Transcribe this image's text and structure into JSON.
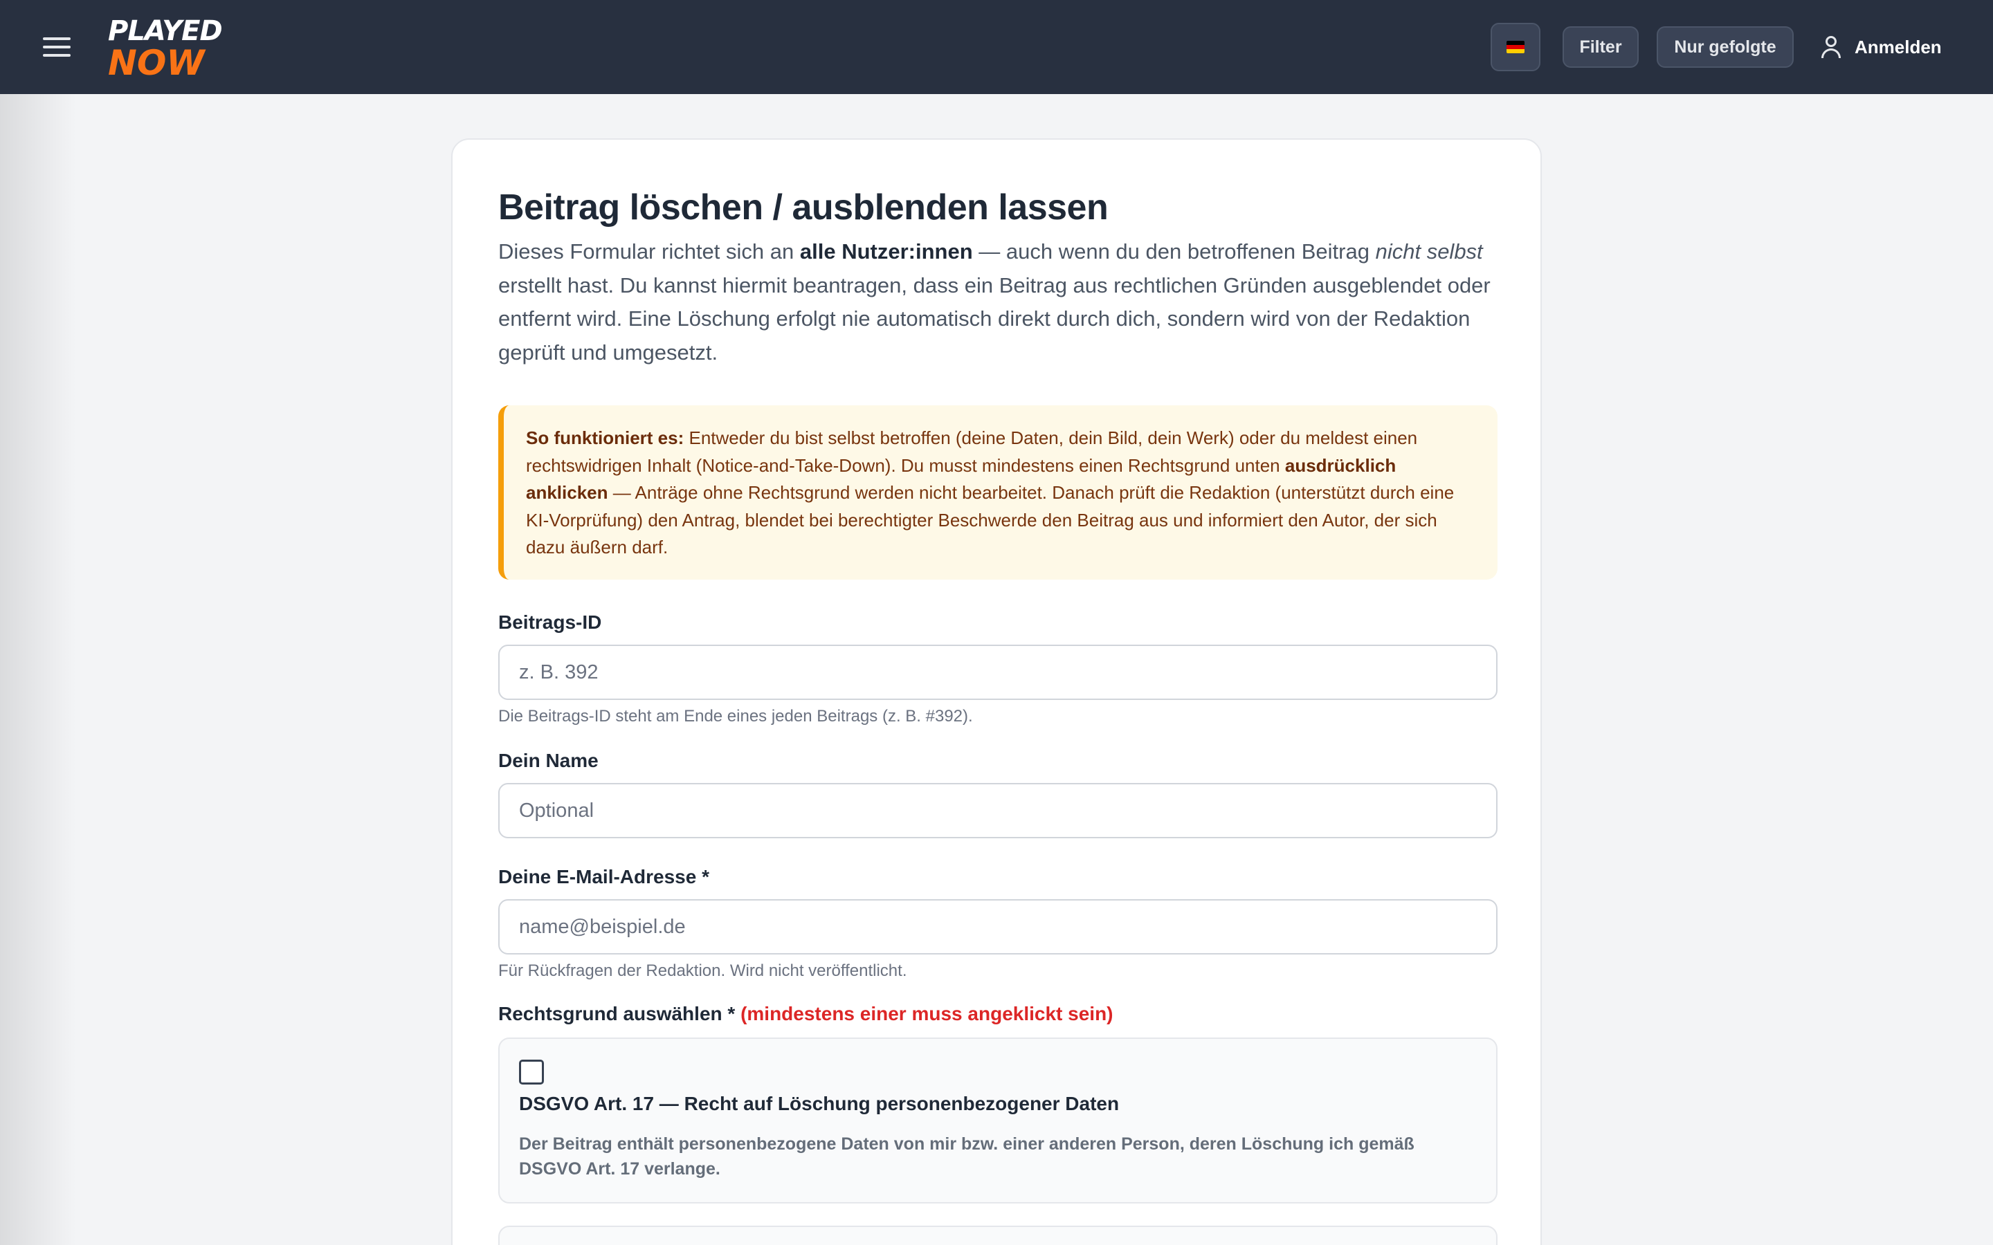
{
  "header": {
    "logo_top": "PLAYED",
    "logo_bottom": "NOW",
    "filter_label": "Filter",
    "follow_label": "Nur gefolgte",
    "login_label": "Anmelden",
    "flag_colors": [
      "#000000",
      "#dd0000",
      "#ffce00"
    ]
  },
  "page": {
    "title": "Beitrag löschen / ausblenden lassen",
    "intro_1": "Dieses Formular richtet sich an ",
    "intro_bold": "alle Nutzer:innen",
    "intro_2": " — auch wenn du den betroffenen Beitrag ",
    "intro_italic": "nicht selbst",
    "intro_3": " erstellt hast. Du kannst hiermit beantragen, dass ein Beitrag aus rechtlichen Gründen ausgeblendet oder entfernt wird. Eine Löschung erfolgt nie automatisch direkt durch dich, sondern wird von der Redaktion geprüft und umgesetzt."
  },
  "notice": {
    "lead": "So funktioniert es:",
    "text_1": " Entweder du bist selbst betroffen (deine Daten, dein Bild, dein Werk) oder du meldest einen rechtswidrigen Inhalt (Notice-and-Take-Down). Du musst mindestens einen Rechtsgrund unten ",
    "bold": "ausdrücklich anklicken",
    "text_2": " — Anträge ohne Rechtsgrund werden nicht bearbeitet. Danach prüft die Redaktion (unterstützt durch eine KI-Vorprüfung) den Antrag, blendet bei berechtigter Beschwerde den Beitrag aus und informiert den Autor, der sich dazu äußern darf."
  },
  "form": {
    "post_id_label": "Beitrags-ID",
    "post_id_placeholder": "z. B. 392",
    "post_id_hint": "Die Beitrags-ID steht am Ende eines jeden Beitrags (z. B. #392).",
    "name_label": "Dein Name",
    "name_placeholder": "Optional",
    "email_label": "Deine E-Mail-Adresse *",
    "email_placeholder": "name@beispiel.de",
    "email_hint": "Für Rückfragen der Redaktion. Wird nicht veröffentlicht.",
    "reason_label": "Rechtsgrund auswählen *",
    "reason_required": "(mindestens einer muss angeklickt sein)",
    "reasons": [
      {
        "title": "DSGVO Art. 17 — Recht auf Löschung personenbezogener Daten",
        "description": "Der Beitrag enthält personenbezogene Daten von mir bzw. einer anderen Person, deren Löschung ich gemäß DSGVO Art. 17 verlange."
      }
    ]
  }
}
